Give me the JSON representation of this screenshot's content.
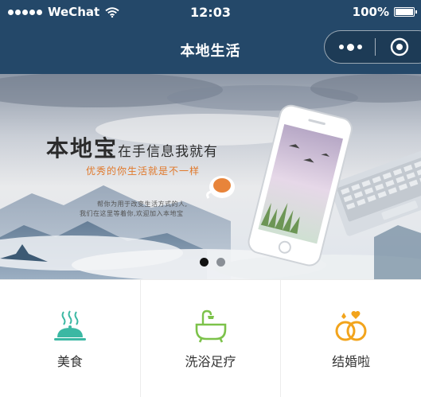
{
  "status_bar": {
    "carrier": "WeChat",
    "time": "12:03",
    "battery": "100%"
  },
  "nav": {
    "title": "本地生活"
  },
  "banner": {
    "headline_big": "本地宝",
    "headline_small": "在手信息我就有",
    "subline": "优秀的你生活就是不一样",
    "body_line1": "帮你为用于改变生活方式的人,",
    "body_line2": "我们在这里等着你,欢迎加入本地宝",
    "active_slide": 1,
    "slide_count": 2
  },
  "menu": {
    "items": [
      {
        "label": "美食",
        "icon": "food-cloche-icon"
      },
      {
        "label": "洗浴足疗",
        "icon": "bathtub-icon"
      },
      {
        "label": "结婚啦",
        "icon": "wedding-rings-icon"
      }
    ]
  },
  "colors": {
    "nav_background": "#244869",
    "food_icon": "#3bb8a3",
    "bath_icon": "#7cc24a",
    "rings_icon": "#f2a41c",
    "banner_accent": "#e0782a"
  }
}
